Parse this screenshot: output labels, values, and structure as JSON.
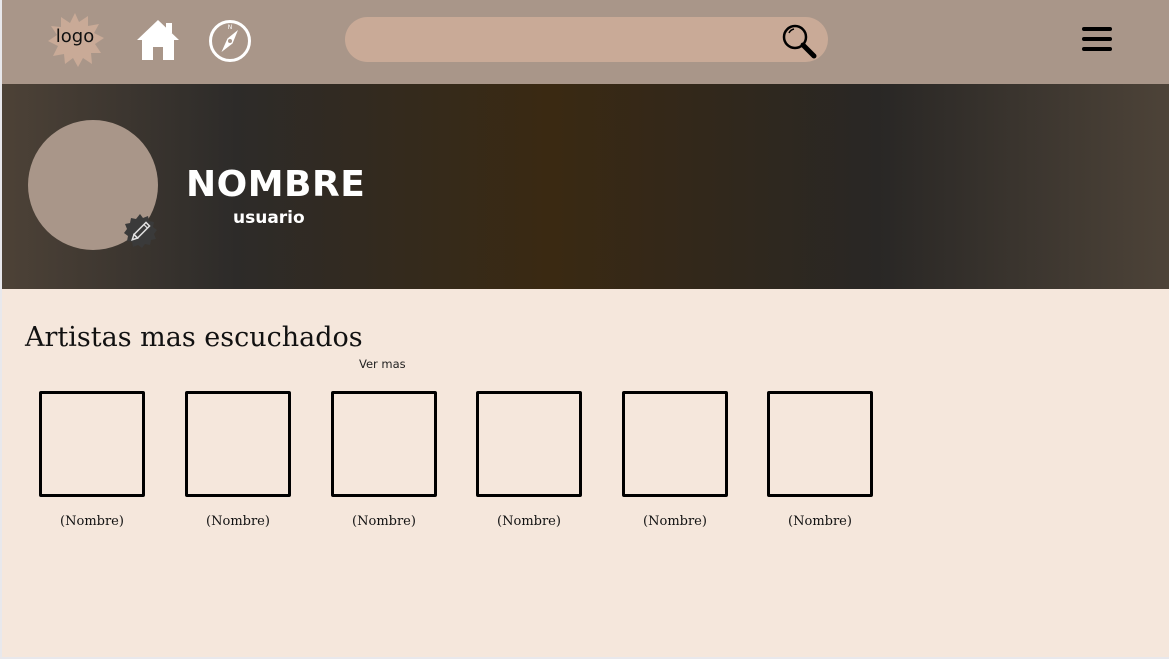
{
  "colors": {
    "topbar": "#a99689",
    "search_bg": "#c9aa97",
    "page_bg": "#f5e7dc",
    "avatar": "#a99689"
  },
  "header": {
    "logo_text": "logo",
    "home_icon": "home-icon",
    "explore_icon": "compass-icon",
    "search": {
      "placeholder": "",
      "value": "",
      "icon": "search-icon"
    },
    "menu_icon": "hamburger-menu-icon"
  },
  "profile": {
    "name": "NOMBRE",
    "username": "usuario",
    "edit_icon": "pencil-icon"
  },
  "top_artists": {
    "title": "Artistas mas escuchados",
    "see_more": "Ver mas",
    "items": [
      {
        "name": "(Nombre)"
      },
      {
        "name": "(Nombre)"
      },
      {
        "name": "(Nombre)"
      },
      {
        "name": "(Nombre)"
      },
      {
        "name": "(Nombre)"
      },
      {
        "name": "(Nombre)"
      }
    ]
  }
}
